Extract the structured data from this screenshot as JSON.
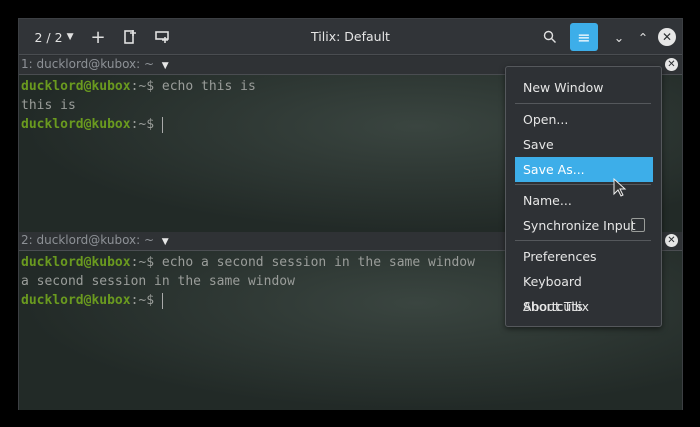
{
  "window": {
    "title": "Tilix: Default",
    "session_counter": "2 / 2"
  },
  "panes": [
    {
      "title": "1: ducklord@kubox: ~",
      "lines": [
        {
          "user": "ducklord@kubox",
          "path": ":~$ ",
          "cmd": "echo this is"
        },
        {
          "output": "this is"
        },
        {
          "user": "ducklord@kubox",
          "path": ":~$ ",
          "cmd": ""
        }
      ]
    },
    {
      "title": "2: ducklord@kubox: ~",
      "lines": [
        {
          "user": "ducklord@kubox",
          "path": ":~$ ",
          "cmd": "echo a second session in the same window"
        },
        {
          "output": "a second session in the same window"
        },
        {
          "user": "ducklord@kubox",
          "path": ":~$ ",
          "cmd": ""
        }
      ]
    }
  ],
  "menu": {
    "items": [
      "New Window",
      "Open...",
      "Save",
      "Save As...",
      "Name...",
      "Synchronize Input",
      "Preferences",
      "Keyboard Shortcuts",
      "About Tilix"
    ],
    "selected": "Save As...",
    "accent": "#3daee9"
  }
}
